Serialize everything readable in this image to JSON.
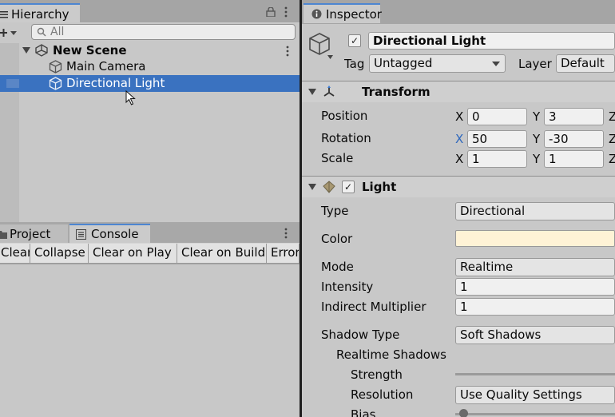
{
  "hierarchy": {
    "tab_label": "Hierarchy",
    "search_placeholder": "All",
    "scene_name": "New Scene",
    "items": [
      {
        "label": "Main Camera"
      },
      {
        "label": "Directional Light"
      }
    ]
  },
  "bottom_panel": {
    "tabs": [
      {
        "label": "Project"
      },
      {
        "label": "Console"
      }
    ],
    "toolbar": [
      "Clear",
      "Collapse",
      "Clear on Play",
      "Clear on Build",
      "Error"
    ]
  },
  "inspector": {
    "tab_label": "Inspector",
    "object_name": "Directional Light",
    "tag_label": "Tag",
    "tag_value": "Untagged",
    "layer_label": "Layer",
    "layer_value": "Default",
    "transform": {
      "title": "Transform",
      "rows": [
        {
          "label": "Position",
          "x": "0",
          "y": "3"
        },
        {
          "label": "Rotation",
          "x": "50",
          "y": "-30"
        },
        {
          "label": "Scale",
          "x": "1",
          "y": "1"
        }
      ],
      "axis_x": "X",
      "axis_y": "Y",
      "axis_z": "Z"
    },
    "light": {
      "title": "Light",
      "type_label": "Type",
      "type_value": "Directional",
      "color_label": "Color",
      "color_value": "#fff3d6",
      "mode_label": "Mode",
      "mode_value": "Realtime",
      "intensity_label": "Intensity",
      "intensity_value": "1",
      "indirect_label": "Indirect Multiplier",
      "indirect_value": "1",
      "shadow_type_label": "Shadow Type",
      "shadow_type_value": "Soft Shadows",
      "realtime_shadows_label": "Realtime Shadows",
      "strength_label": "Strength",
      "resolution_label": "Resolution",
      "resolution_value": "Use Quality Settings",
      "bias_label": "Bias"
    }
  },
  "colors": {
    "selection": "#3a72c0",
    "tab_accent": "#4d86d1"
  }
}
